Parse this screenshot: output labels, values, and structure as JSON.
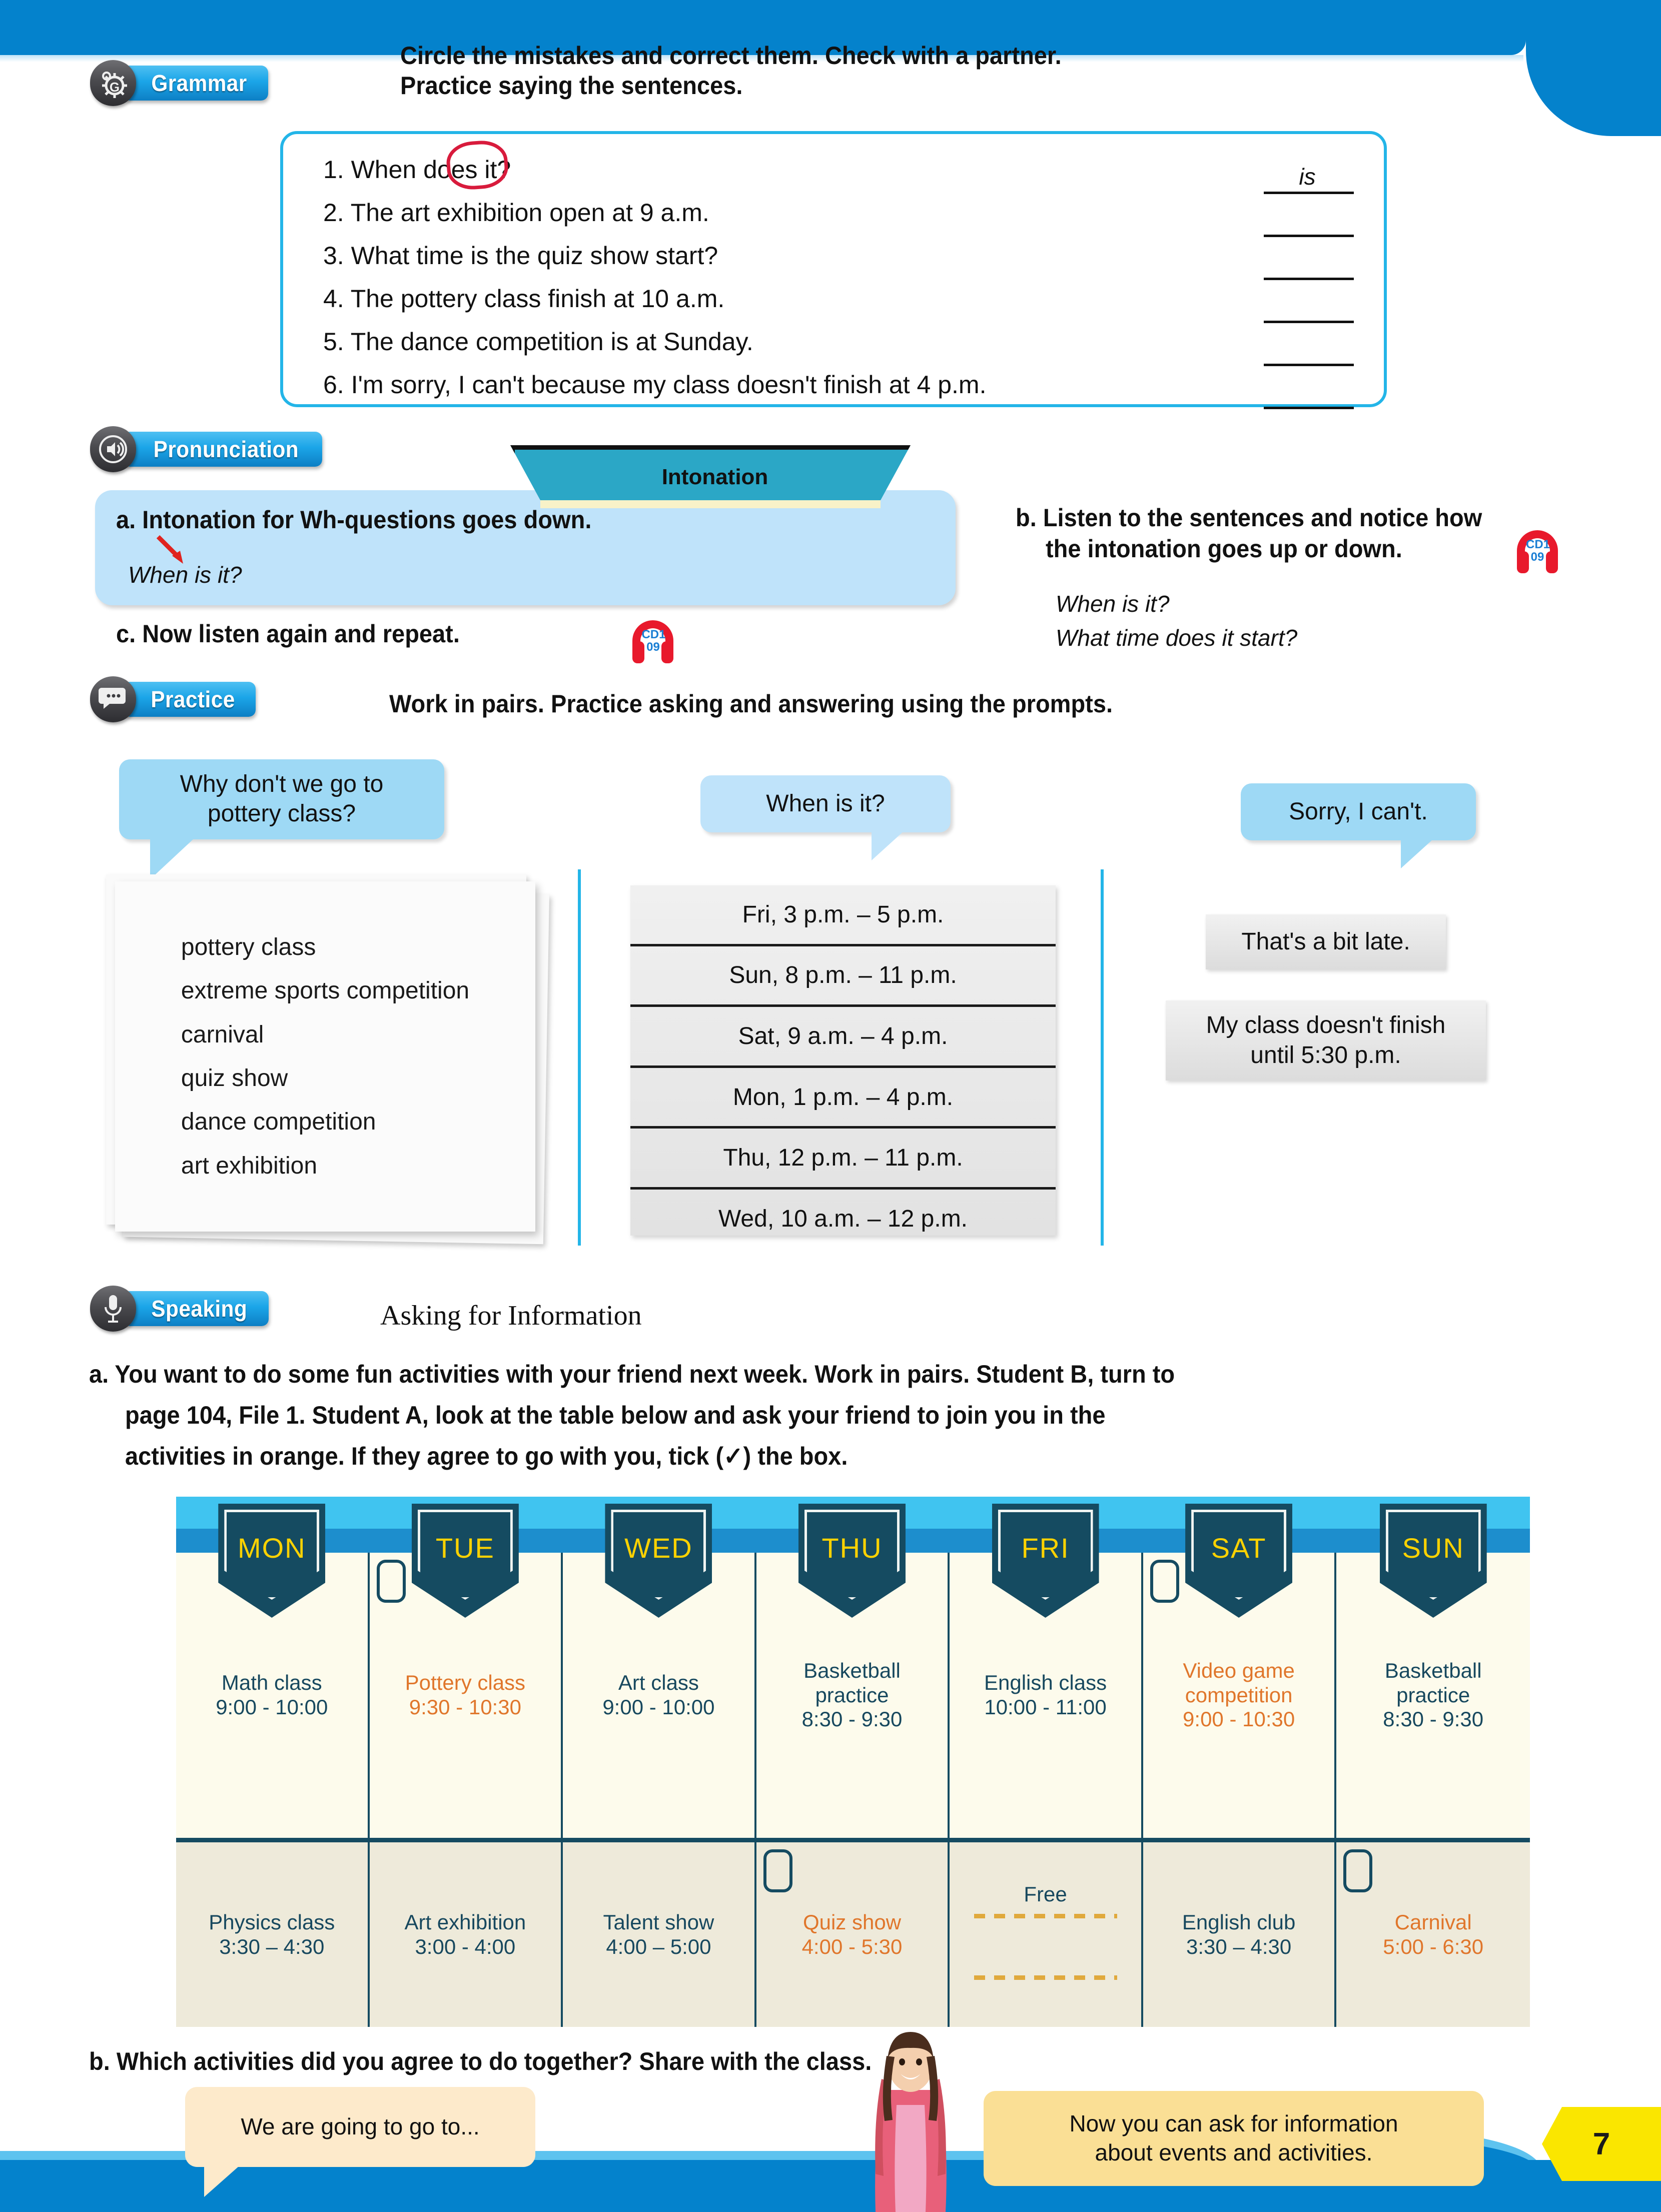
{
  "page": {
    "number": "7"
  },
  "grammar": {
    "badge": "Grammar",
    "badge_icon": "gear-g-icon",
    "instruction_line1": "Circle the mistakes and correct them. Check with a partner.",
    "instruction_line2": "Practice saying the sentences.",
    "items": [
      {
        "num": "1.",
        "text": "When does it?",
        "answer": "is"
      },
      {
        "num": "2.",
        "text": "The art exhibition open at 9 a.m.",
        "answer": ""
      },
      {
        "num": "3.",
        "text": "What time is the quiz show start?",
        "answer": ""
      },
      {
        "num": "4.",
        "text": "The pottery class finish at 10 a.m.",
        "answer": ""
      },
      {
        "num": "5.",
        "text": "The dance competition is at Sunday.",
        "answer": ""
      },
      {
        "num": "6.",
        "text": "I'm sorry, I can't because my class doesn't finish at 4 p.m.",
        "answer": ""
      }
    ]
  },
  "pronunciation": {
    "badge": "Pronunciation",
    "badge_icon": "speaker-mouth-icon",
    "tab_label": "Intonation",
    "a_text": "a. Intonation for Wh-questions goes down.",
    "a_example": "When is it?",
    "b_line1": "b. Listen to the sentences and notice how",
    "b_line2": "the intonation goes up or down.",
    "b_example1": "When is it?",
    "b_example2": "What time does it start?",
    "c_text": "c. Now listen again and repeat.",
    "cd_top": "CD1",
    "cd_bottom": "09"
  },
  "practice": {
    "badge": "Practice",
    "badge_icon": "speech-bubbles-icon",
    "instruction": "Work in pairs. Practice asking and answering using the prompts.",
    "bubble_ask": "Why don't we go to\npottery class?",
    "bubble_when": "When is it?",
    "bubble_sorry": "Sorry, I can't.",
    "activities": [
      "pottery class",
      "extreme sports competition",
      "carnival",
      "quiz show",
      "dance competition",
      "art exhibition"
    ],
    "times": [
      "Fri, 3 p.m. – 5 p.m.",
      "Sun, 8 p.m. – 11 p.m.",
      "Sat, 9 a.m. – 4 p.m.",
      "Mon, 1 p.m. – 4 p.m.",
      "Thu, 12 p.m. – 11 p.m.",
      "Wed, 10 a.m. – 12 p.m."
    ],
    "note_late": "That's a bit late.",
    "note_finish": "My class doesn't finish\nuntil 5:30 p.m."
  },
  "speaking": {
    "badge": "Speaking",
    "badge_icon": "microphone-icon",
    "title": "Asking for Information",
    "a_line1": "a. You want to do some fun activities with your friend next week. Work in pairs. Student B, turn to",
    "a_line2": "page 104, File 1. Student A, look at the table below and ask your friend to join you in the",
    "a_line3": "activities in orange. If they agree to go with you, tick (✓) the box.",
    "b_text": "b. Which activities did you agree to do together? Share with the class.",
    "footer_bubble_left": "We are going to go to...",
    "footer_bubble_right": "Now you can ask for information\nabout events and activities."
  },
  "schedule": {
    "days": [
      "MON",
      "TUE",
      "WED",
      "THU",
      "FRI",
      "SAT",
      "SUN"
    ],
    "colors": {
      "dark": "#17485e",
      "orange": "#e0762b",
      "banner": "#154b61",
      "day_text": "#ffd200"
    },
    "rows": [
      [
        {
          "title": "Math class",
          "time": "9:00 - 10:00",
          "highlight": false,
          "checkbox": false
        },
        {
          "title": "Pottery class",
          "time": "9:30 - 10:30",
          "highlight": true,
          "checkbox": true
        },
        {
          "title": "Art class",
          "time": "9:00 - 10:00",
          "highlight": false,
          "checkbox": false
        },
        {
          "title": "Basketball\npractice",
          "time": "8:30 - 9:30",
          "highlight": false,
          "checkbox": false
        },
        {
          "title": "English class",
          "time": "10:00 - 11:00",
          "highlight": false,
          "checkbox": false
        },
        {
          "title": "Video game\ncompetition",
          "time": "9:00 - 10:30",
          "highlight": true,
          "checkbox": true
        },
        {
          "title": "Basketball\npractice",
          "time": "8:30 - 9:30",
          "highlight": false,
          "checkbox": false
        }
      ],
      [
        {
          "title": "Physics class",
          "time": "3:30 – 4:30",
          "highlight": false,
          "checkbox": false
        },
        {
          "title": "Art exhibition",
          "time": "3:00 - 4:00",
          "highlight": false,
          "checkbox": false
        },
        {
          "title": "Talent show",
          "time": "4:00 – 5:00",
          "highlight": false,
          "checkbox": false
        },
        {
          "title": "Quiz show",
          "time": "4:00 - 5:30",
          "highlight": true,
          "checkbox": true
        },
        {
          "title": "Free",
          "time": "",
          "highlight": false,
          "checkbox": false,
          "free": true
        },
        {
          "title": "English club",
          "time": "3:30 – 4:30",
          "highlight": false,
          "checkbox": false
        },
        {
          "title": "Carnival",
          "time": "5:00 - 6:30",
          "highlight": true,
          "checkbox": true
        }
      ]
    ]
  }
}
